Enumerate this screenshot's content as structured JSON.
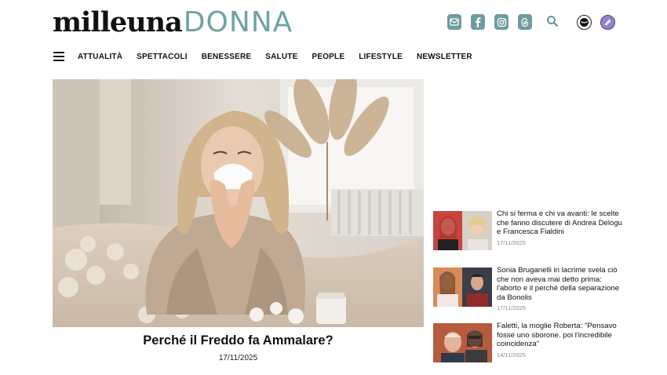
{
  "header": {
    "logo_part1": "milleuna",
    "logo_part2": "DONNA",
    "social_icons": [
      "newsletter-icon",
      "facebook-icon",
      "instagram-icon",
      "threads-icon"
    ],
    "search_icon": "search-icon",
    "brand_icons": [
      "brand-badge-a",
      "brand-badge-b"
    ],
    "accent_color": "#6fa3a3"
  },
  "nav": {
    "menu_icon": "hamburger-icon",
    "items": [
      "ATTUALITÀ",
      "SPETTACOLI",
      "BENESSERE",
      "SALUTE",
      "PEOPLE",
      "LIFESTYLE",
      "NEWSLETTER"
    ]
  },
  "hero": {
    "title": "Perché il Freddo fa Ammalare?",
    "date": "17/11/2025"
  },
  "side": [
    {
      "title": "Chi si ferma e chi va avanti: le scelte che fanno discutere di Andrea Delogu e Francesca Fialdini",
      "date": "17/11/2025"
    },
    {
      "title": "Sonia Bruganelli in lacrime svela ciò che non aveva mai detto prima: l'aborto e il perché della separazione da Bonolis",
      "date": "17/11/2025"
    },
    {
      "title": "Faletti, la moglie Roberta: \"Pensavo fosse uno sborone. poi l'incredibile coincidenza\"",
      "date": "14/11/2025"
    }
  ]
}
